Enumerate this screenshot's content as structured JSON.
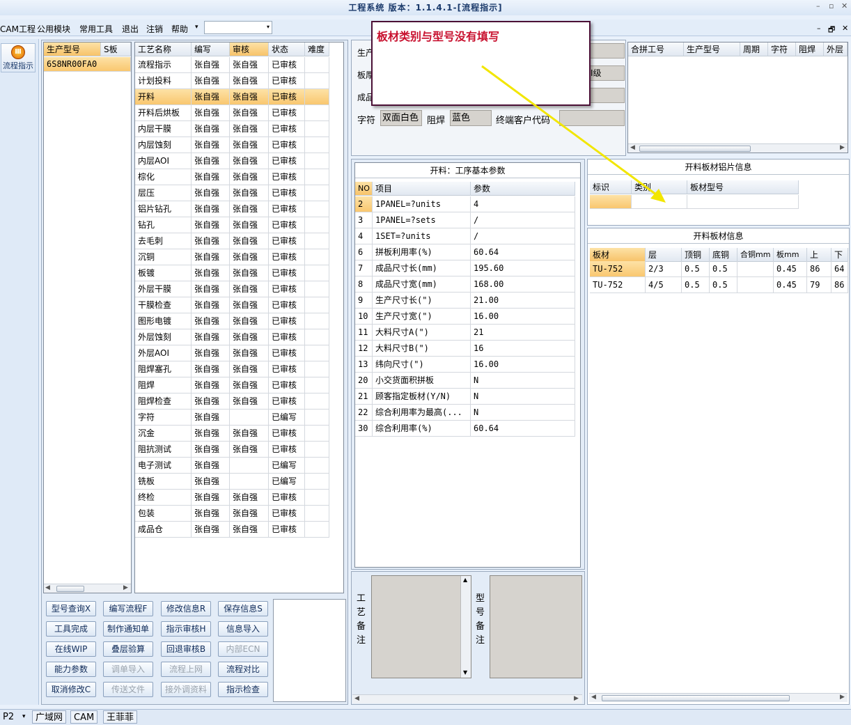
{
  "window": {
    "title": "工程系统  版本：1.1.4.1-[流程指示]",
    "winctl_min": "–",
    "winctl_max": "▫",
    "winctl_close": "✕"
  },
  "menubar": {
    "items": [
      "CAM工程",
      "公用模块",
      "常用工具",
      "退出",
      "注销",
      "帮助"
    ],
    "dropdown_arrow": "▾",
    "combo_value": "",
    "mdi_min": "–",
    "mdi_restore": "🗗",
    "mdi_close": "✕"
  },
  "nav": {
    "flow_button_label": "流程指示",
    "flow_icon": "Ⅲ"
  },
  "models_table": {
    "headers": [
      "生产型号",
      "S板"
    ],
    "rows": [
      [
        "6S8NR00FA0",
        ""
      ]
    ]
  },
  "process_table": {
    "headers": [
      "工艺名称",
      "编写",
      "审核",
      "状态",
      "难度"
    ],
    "selected_row": 2,
    "rows": [
      [
        "流程指示",
        "张自强",
        "张自强",
        "已审核",
        ""
      ],
      [
        "计划投料",
        "张自强",
        "张自强",
        "已审核",
        ""
      ],
      [
        "开料",
        "张自强",
        "张自强",
        "已审核",
        ""
      ],
      [
        "开料后烘板",
        "张自强",
        "张自强",
        "已审核",
        ""
      ],
      [
        "内层干膜",
        "张自强",
        "张自强",
        "已审核",
        ""
      ],
      [
        "内层蚀刻",
        "张自强",
        "张自强",
        "已审核",
        ""
      ],
      [
        "内层AOI",
        "张自强",
        "张自强",
        "已审核",
        ""
      ],
      [
        "棕化",
        "张自强",
        "张自强",
        "已审核",
        ""
      ],
      [
        "层压",
        "张自强",
        "张自强",
        "已审核",
        ""
      ],
      [
        "铝片钻孔",
        "张自强",
        "张自强",
        "已审核",
        ""
      ],
      [
        "钻孔",
        "张自强",
        "张自强",
        "已审核",
        ""
      ],
      [
        "去毛刺",
        "张自强",
        "张自强",
        "已审核",
        ""
      ],
      [
        "沉铜",
        "张自强",
        "张自强",
        "已审核",
        ""
      ],
      [
        "板镀",
        "张自强",
        "张自强",
        "已审核",
        ""
      ],
      [
        "外层干膜",
        "张自强",
        "张自强",
        "已审核",
        ""
      ],
      [
        "干膜检查",
        "张自强",
        "张自强",
        "已审核",
        ""
      ],
      [
        "图形电镀",
        "张自强",
        "张自强",
        "已审核",
        ""
      ],
      [
        "外层蚀刻",
        "张自强",
        "张自强",
        "已审核",
        ""
      ],
      [
        "外层AOI",
        "张自强",
        "张自强",
        "已审核",
        ""
      ],
      [
        "阻焊塞孔",
        "张自强",
        "张自强",
        "已审核",
        ""
      ],
      [
        "阻焊",
        "张自强",
        "张自强",
        "已审核",
        ""
      ],
      [
        "阻焊检查",
        "张自强",
        "张自强",
        "已审核",
        ""
      ],
      [
        "字符",
        "张自强",
        "",
        "已编写",
        ""
      ],
      [
        "沉金",
        "张自强",
        "张自强",
        "已审核",
        ""
      ],
      [
        "阻抗测试",
        "张自强",
        "张自强",
        "已审核",
        ""
      ],
      [
        "电子测试",
        "张自强",
        "",
        "已编写",
        ""
      ],
      [
        "铣板",
        "张自强",
        "",
        "已编写",
        ""
      ],
      [
        "终检",
        "张自强",
        "张自强",
        "已审核",
        ""
      ],
      [
        "包装",
        "张自强",
        "张自强",
        "已审核",
        ""
      ],
      [
        "成品仓",
        "张自强",
        "张自强",
        "已审核",
        ""
      ]
    ]
  },
  "buttons": [
    [
      "型号查询X",
      "编写流程F",
      "修改信息R",
      "保存信息S"
    ],
    [
      "工具完成",
      "制作通知单",
      "指示审核H",
      "信息导入"
    ],
    [
      "在线WIP",
      "叠层验算",
      "回退审核B",
      "内部ECN"
    ],
    [
      "能力参数",
      "调单导入",
      "流程上网",
      "流程对比"
    ],
    [
      "取消修改C",
      "传送文件",
      "接外调资料",
      "指示检查"
    ]
  ],
  "disabled_buttons": [
    "内部ECN",
    "调单导入",
    "流程上网",
    "传送文件",
    "接外调资料"
  ],
  "info": {
    "l1": "生产",
    "l2": "板厚",
    "l3": "成品",
    "grade": "I级",
    "char_label": "字符",
    "char_value": "双面白色",
    "mask_label": "阻焊",
    "mask_value": "蓝色",
    "cust_label": "终端客户代码",
    "cust_value": ""
  },
  "tooltip": {
    "message": "板材类别与型号没有填写"
  },
  "combo_table": {
    "headers": [
      "合拼工号",
      "生产型号",
      "周期",
      "字符",
      "阻焊",
      "外层"
    ]
  },
  "params": {
    "title": "开料：工序基本参数",
    "headers": [
      "NO",
      "项目",
      "参数"
    ],
    "rows": [
      [
        "2",
        "1PANEL=?units",
        "4"
      ],
      [
        "3",
        "1PANEL=?sets",
        "/"
      ],
      [
        "4",
        "1SET=?units",
        "/"
      ],
      [
        "6",
        "拼板利用率(%)",
        "60.64"
      ],
      [
        "7",
        "成品尺寸长(mm)",
        "195.60"
      ],
      [
        "8",
        "成品尺寸宽(mm)",
        "168.00"
      ],
      [
        "9",
        "生产尺寸长(\")",
        "21.00"
      ],
      [
        "10",
        "生产尺寸宽(\")",
        "16.00"
      ],
      [
        "11",
        "大料尺寸A(\")",
        "21"
      ],
      [
        "12",
        "大料尺寸B(\")",
        "16"
      ],
      [
        "13",
        "纬向尺寸(\")",
        "16.00"
      ],
      [
        "20",
        "小交货面积拼板",
        "N"
      ],
      [
        "21",
        "顾客指定板材(Y/N)",
        "N"
      ],
      [
        "22",
        "综合利用率为最高(...",
        "N"
      ],
      [
        "30",
        "综合利用率(%)",
        "60.64"
      ]
    ]
  },
  "alu": {
    "title": "开料板材铝片信息",
    "headers": [
      "标识",
      "类别",
      "板材型号"
    ]
  },
  "material": {
    "title": "开料板材信息",
    "headers": [
      "板材",
      "层",
      "顶铜",
      "底铜",
      "合铜mm",
      "板mm",
      "上",
      "下"
    ],
    "rows": [
      [
        "TU-752",
        "2/3",
        "0.5",
        "0.5",
        "",
        "0.45",
        "86",
        "64"
      ],
      [
        "TU-752",
        "4/5",
        "0.5",
        "0.5",
        "",
        "0.45",
        "79",
        "86"
      ]
    ]
  },
  "notes": {
    "proc_label": [
      "工",
      "艺",
      "备",
      "注"
    ],
    "model_label": [
      "型",
      "号",
      "备",
      "注"
    ]
  },
  "statusbar": {
    "left": "P2",
    "net": "广域网",
    "mode": "CAM",
    "user": "王菲菲"
  }
}
